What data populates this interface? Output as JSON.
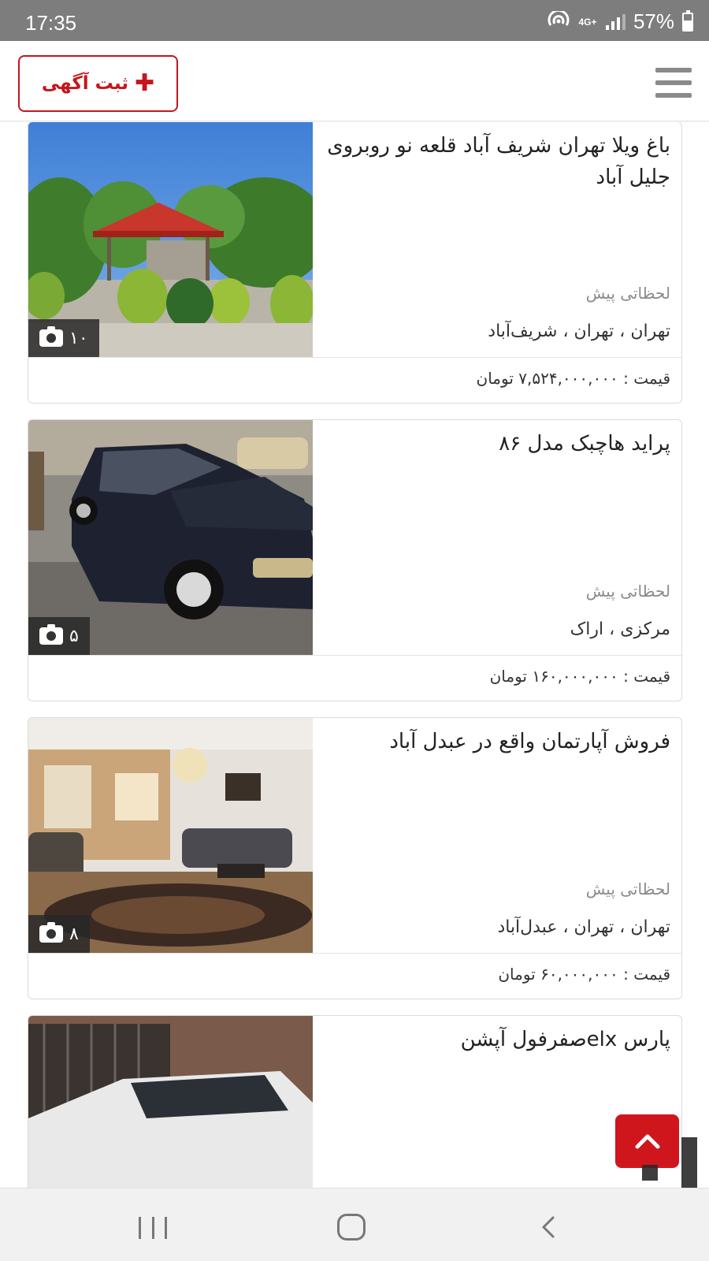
{
  "status_bar": {
    "time": "17:35",
    "network": "4G+",
    "battery": "57%",
    "icons": [
      "hotspot-icon",
      "network-4g-icon",
      "signal-icon",
      "battery-icon"
    ]
  },
  "header": {
    "post_ad_label": "ثبت آگهی",
    "post_ad_icon": "plus-icon",
    "menu_icon": "hamburger-menu-icon",
    "accent_color": "#c4161c"
  },
  "listings": [
    {
      "title": "باغ ویلا تهران شریف آباد قلعه نو روبروی جلیل آباد",
      "time": "لحظاتی پیش",
      "location": "تهران ، تهران ، شریف‌آباد",
      "price": "قیمت : ۷,۵۲۴,۰۰۰,۰۰۰ تومان",
      "photo_count": "۱۰",
      "image": "garden-villa-gazebo"
    },
    {
      "title": "پراید هاچبک مدل ۸۶",
      "time": "لحظاتی پیش",
      "location": "مرکزی ، اراک",
      "price": "قیمت : ۱۶۰,۰۰۰,۰۰۰ تومان",
      "photo_count": "۵",
      "image": "dark-hatchback-car"
    },
    {
      "title": "فروش آپارتمان واقع در عبدل آباد",
      "time": "لحظاتی پیش",
      "location": "تهران ، تهران ، عبدل‌آباد",
      "price": "قیمت : ۶۰,۰۰۰,۰۰۰ تومان",
      "photo_count": "۸",
      "image": "apartment-living-room"
    },
    {
      "title": "پارس elxصفرفول آپشن",
      "time": "",
      "location": "",
      "price": "",
      "photo_count": "",
      "image": "white-sedan-car"
    }
  ],
  "floating": {
    "scroll_top_icon": "chevron-up-icon",
    "scroll_top_color": "#d0161d"
  },
  "nav_bar": {
    "icons": [
      "recents-icon",
      "home-icon",
      "back-icon"
    ]
  }
}
